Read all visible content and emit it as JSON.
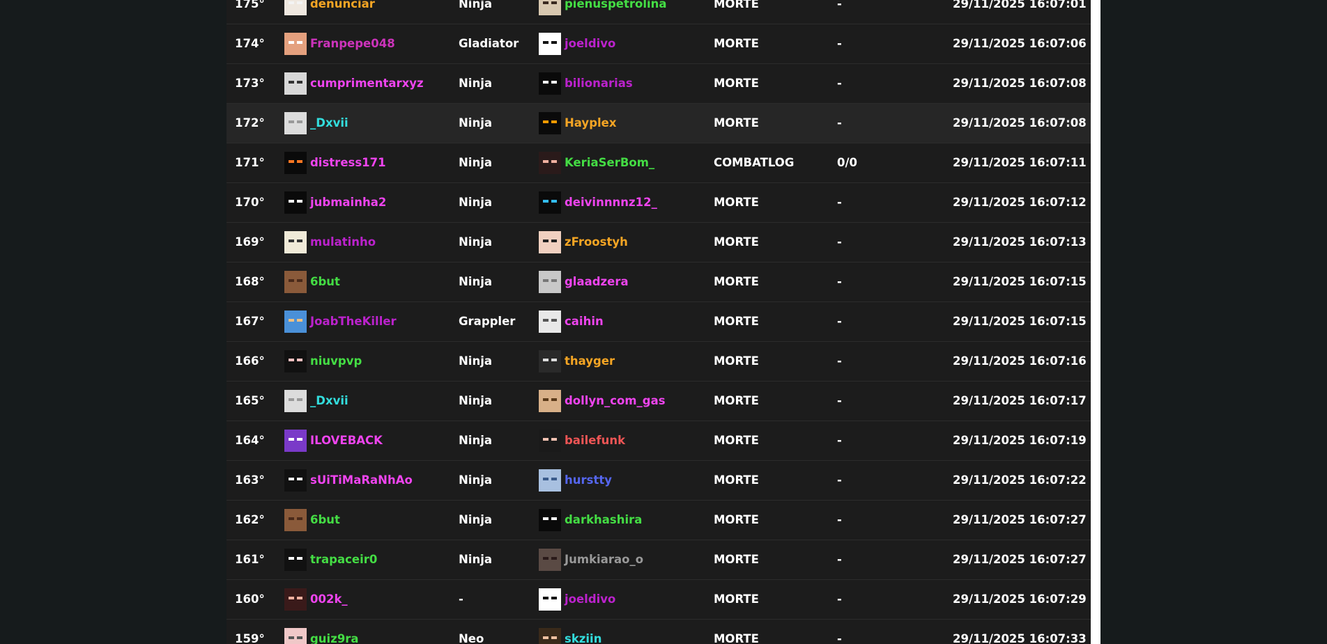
{
  "rows": [
    {
      "pos": "175°",
      "att": {
        "name": "denunciar",
        "color": "#f5a524",
        "skin": {
          "bg": "#efe8e0",
          "eye": "#f3f3f3"
        }
      },
      "kit": "Ninja",
      "vic": {
        "name": "pienuspetrolina",
        "color": "#44dd44",
        "skin": {
          "bg": "#d8c8b0",
          "eye": "#3a2a20"
        }
      },
      "type": "MORTE",
      "kd": "-",
      "date": "29/11/2025 16:07:01"
    },
    {
      "pos": "174°",
      "att": {
        "name": "Franpepe048",
        "color": "#cc33bb",
        "skin": {
          "bg": "#e4a07e",
          "eye": "#ffffff"
        }
      },
      "kit": "Gladiator",
      "vic": {
        "name": "joeldivo",
        "color": "#bb22cc",
        "skin": {
          "bg": "#ffffff",
          "eye": "#111111"
        }
      },
      "type": "MORTE",
      "kd": "-",
      "date": "29/11/2025 16:07:06"
    },
    {
      "pos": "173°",
      "att": {
        "name": "cumprimentarxyz",
        "color": "#ee44ee",
        "skin": {
          "bg": "#d8d8d8",
          "eye": "#333333"
        }
      },
      "kit": "Ninja",
      "vic": {
        "name": "bilionarias",
        "color": "#bb22cc",
        "skin": {
          "bg": "#0a0a0a",
          "eye": "#ffffff"
        }
      },
      "type": "MORTE",
      "kd": "-",
      "date": "29/11/2025 16:07:08"
    },
    {
      "pos": "172°",
      "att": {
        "name": "_Dxvii",
        "color": "#33dddd",
        "skin": {
          "bg": "#dcdcdc",
          "eye": "#999999"
        }
      },
      "kit": "Ninja",
      "vic": {
        "name": "Hayplex",
        "color": "#f5a524",
        "skin": {
          "bg": "#0a0a0a",
          "eye": "#f59a00"
        }
      },
      "type": "MORTE",
      "kd": "-",
      "date": "29/11/2025 16:07:08"
    },
    {
      "pos": "171°",
      "att": {
        "name": "distress171",
        "color": "#ee44ee",
        "skin": {
          "bg": "#0a0a0a",
          "eye": "#ff7722"
        }
      },
      "kit": "Ninja",
      "vic": {
        "name": "KeriaSerBom_",
        "color": "#44dd44",
        "skin": {
          "bg": "#2a1a1a",
          "eye": "#f0b0a0"
        }
      },
      "type": "COMBATLOG",
      "kd": "0/0",
      "date": "29/11/2025 16:07:11"
    },
    {
      "pos": "170°",
      "att": {
        "name": "jubmainha2",
        "color": "#ee44ee",
        "skin": {
          "bg": "#0a0a0a",
          "eye": "#ffffff"
        }
      },
      "kit": "Ninja",
      "vic": {
        "name": "deivinnnnz12_",
        "color": "#ee44ee",
        "skin": {
          "bg": "#0a0a0a",
          "eye": "#33bbee"
        }
      },
      "type": "MORTE",
      "kd": "-",
      "date": "29/11/2025 16:07:12"
    },
    {
      "pos": "169°",
      "att": {
        "name": "mulatinho",
        "color": "#bb22cc",
        "skin": {
          "bg": "#f0ead8",
          "eye": "#333333"
        }
      },
      "kit": "Ninja",
      "vic": {
        "name": "zFroostyh",
        "color": "#f5a524",
        "skin": {
          "bg": "#f0d0c0",
          "eye": "#222222"
        }
      },
      "type": "MORTE",
      "kd": "-",
      "date": "29/11/2025 16:07:13"
    },
    {
      "pos": "168°",
      "att": {
        "name": "6but",
        "color": "#44dd44",
        "skin": {
          "bg": "#8a5a3a",
          "eye": "#4a2a1a"
        }
      },
      "kit": "Ninja",
      "vic": {
        "name": "glaadzera",
        "color": "#ee44ee",
        "skin": {
          "bg": "#c8c8c8",
          "eye": "#777777"
        }
      },
      "type": "MORTE",
      "kd": "-",
      "date": "29/11/2025 16:07:15"
    },
    {
      "pos": "167°",
      "att": {
        "name": "JoabTheKiller",
        "color": "#bb22cc",
        "skin": {
          "bg": "#4a90d8",
          "eye": "#f0c080"
        }
      },
      "kit": "Grappler",
      "vic": {
        "name": "caihin",
        "color": "#ee44ee",
        "skin": {
          "bg": "#e8e8e8",
          "eye": "#555555"
        }
      },
      "type": "MORTE",
      "kd": "-",
      "date": "29/11/2025 16:07:15"
    },
    {
      "pos": "166°",
      "att": {
        "name": "niuvpvp",
        "color": "#44dd44",
        "skin": {
          "bg": "#111111",
          "eye": "#f0c0c0"
        }
      },
      "kit": "Ninja",
      "vic": {
        "name": "thayger",
        "color": "#f5a524",
        "skin": {
          "bg": "#2a2a2a",
          "eye": "#dddddd"
        }
      },
      "type": "MORTE",
      "kd": "-",
      "date": "29/11/2025 16:07:16"
    },
    {
      "pos": "165°",
      "att": {
        "name": "_Dxvii",
        "color": "#33dddd",
        "skin": {
          "bg": "#dcdcdc",
          "eye": "#999999"
        }
      },
      "kit": "Ninja",
      "vic": {
        "name": "dollyn_com_gas",
        "color": "#ee44ee",
        "skin": {
          "bg": "#d8b088",
          "eye": "#5a3a1a"
        }
      },
      "type": "MORTE",
      "kd": "-",
      "date": "29/11/2025 16:07:17"
    },
    {
      "pos": "164°",
      "att": {
        "name": "ILOVEBACK",
        "color": "#ee44ee",
        "skin": {
          "bg": "#7a3ac8",
          "eye": "#ffffff"
        }
      },
      "kit": "Ninja",
      "vic": {
        "name": "bailefunk",
        "color": "#ee5555",
        "skin": {
          "bg": "#1a1a1a",
          "eye": "#f0c0b0"
        }
      },
      "type": "MORTE",
      "kd": "-",
      "date": "29/11/2025 16:07:19"
    },
    {
      "pos": "163°",
      "att": {
        "name": "sUiTiMaRaNhAo",
        "color": "#ee44ee",
        "skin": {
          "bg": "#111111",
          "eye": "#eeeeee"
        }
      },
      "kit": "Ninja",
      "vic": {
        "name": "hurstty",
        "color": "#5566ee",
        "skin": {
          "bg": "#a8c0e0",
          "eye": "#3a5a8a"
        }
      },
      "type": "MORTE",
      "kd": "-",
      "date": "29/11/2025 16:07:22"
    },
    {
      "pos": "162°",
      "att": {
        "name": "6but",
        "color": "#44dd44",
        "skin": {
          "bg": "#8a5a3a",
          "eye": "#4a2a1a"
        }
      },
      "kit": "Ninja",
      "vic": {
        "name": "darkhashira",
        "color": "#44dd44",
        "skin": {
          "bg": "#0a0a0a",
          "eye": "#ffffff"
        }
      },
      "type": "MORTE",
      "kd": "-",
      "date": "29/11/2025 16:07:27"
    },
    {
      "pos": "161°",
      "att": {
        "name": "trapaceir0",
        "color": "#44dd44",
        "skin": {
          "bg": "#111111",
          "eye": "#ffffff"
        }
      },
      "kit": "Ninja",
      "vic": {
        "name": "Jumkiarao_o",
        "color": "#999999",
        "skin": {
          "bg": "#5a4a44",
          "eye": "#2a1a1a"
        }
      },
      "type": "MORTE",
      "kd": "-",
      "date": "29/11/2025 16:07:27"
    },
    {
      "pos": "160°",
      "att": {
        "name": "002k_",
        "color": "#ee44ee",
        "skin": {
          "bg": "#3a1a1a",
          "eye": "#f0b0a0"
        }
      },
      "kit": "-",
      "vic": {
        "name": "joeldivo",
        "color": "#bb22cc",
        "skin": {
          "bg": "#ffffff",
          "eye": "#111111"
        }
      },
      "type": "MORTE",
      "kd": "-",
      "date": "29/11/2025 16:07:29"
    },
    {
      "pos": "159°",
      "att": {
        "name": "guiz9ra",
        "color": "#44dd44",
        "skin": {
          "bg": "#f0c8c8",
          "eye": "#555555"
        }
      },
      "kit": "Neo",
      "vic": {
        "name": "skziin",
        "color": "#33dddd",
        "skin": {
          "bg": "#3a2a1a",
          "eye": "#f0c0a0"
        }
      },
      "type": "MORTE",
      "kd": "-",
      "date": "29/11/2025 16:07:33"
    }
  ],
  "highlighted_row": 3
}
